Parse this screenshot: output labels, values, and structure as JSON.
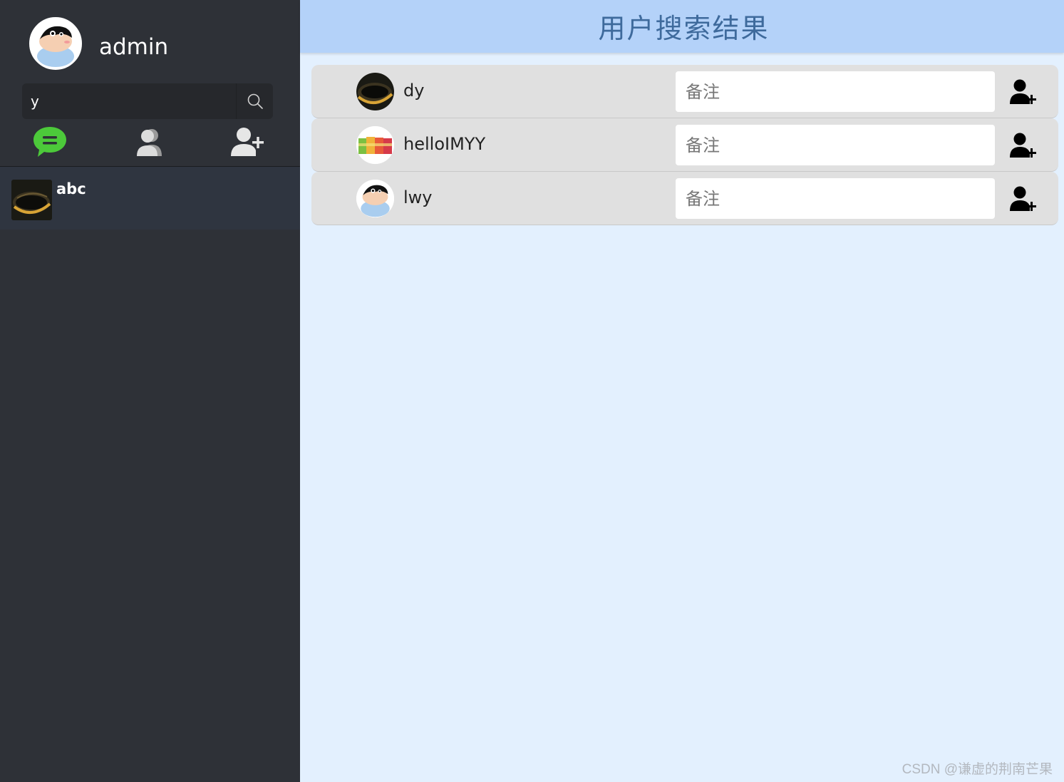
{
  "sidebar": {
    "user": {
      "name": "admin",
      "avatar": "cartoon-avatar"
    },
    "search": {
      "value": "y",
      "placeholder": ""
    },
    "nav": [
      {
        "name": "chat-icon",
        "color": "#4cc93a"
      },
      {
        "name": "contacts-icon",
        "color": "#d8d8d8"
      },
      {
        "name": "add-friend-icon",
        "color": "#e6e6e6"
      }
    ],
    "contacts": [
      {
        "name": "abc",
        "avatar": "eye-photo"
      }
    ]
  },
  "main": {
    "title": "用户搜索结果",
    "results": [
      {
        "name": "dy",
        "avatar": "eye-photo",
        "remark_placeholder": "备注"
      },
      {
        "name": "helloIMYY",
        "avatar": "drinks-photo",
        "remark_placeholder": "备注"
      },
      {
        "name": "lwy",
        "avatar": "cartoon-avatar",
        "remark_placeholder": "备注"
      }
    ]
  },
  "watermark": "CSDN @谦虚的荆南芒果",
  "colors": {
    "sidebar_bg": "#2e3137",
    "title_bar_bg": "#b4d2f9",
    "title_text": "#3e6a9c",
    "main_bg": "#e3f0fe",
    "row_bg": "#e0e0e0",
    "chat_green": "#4cc93a"
  }
}
